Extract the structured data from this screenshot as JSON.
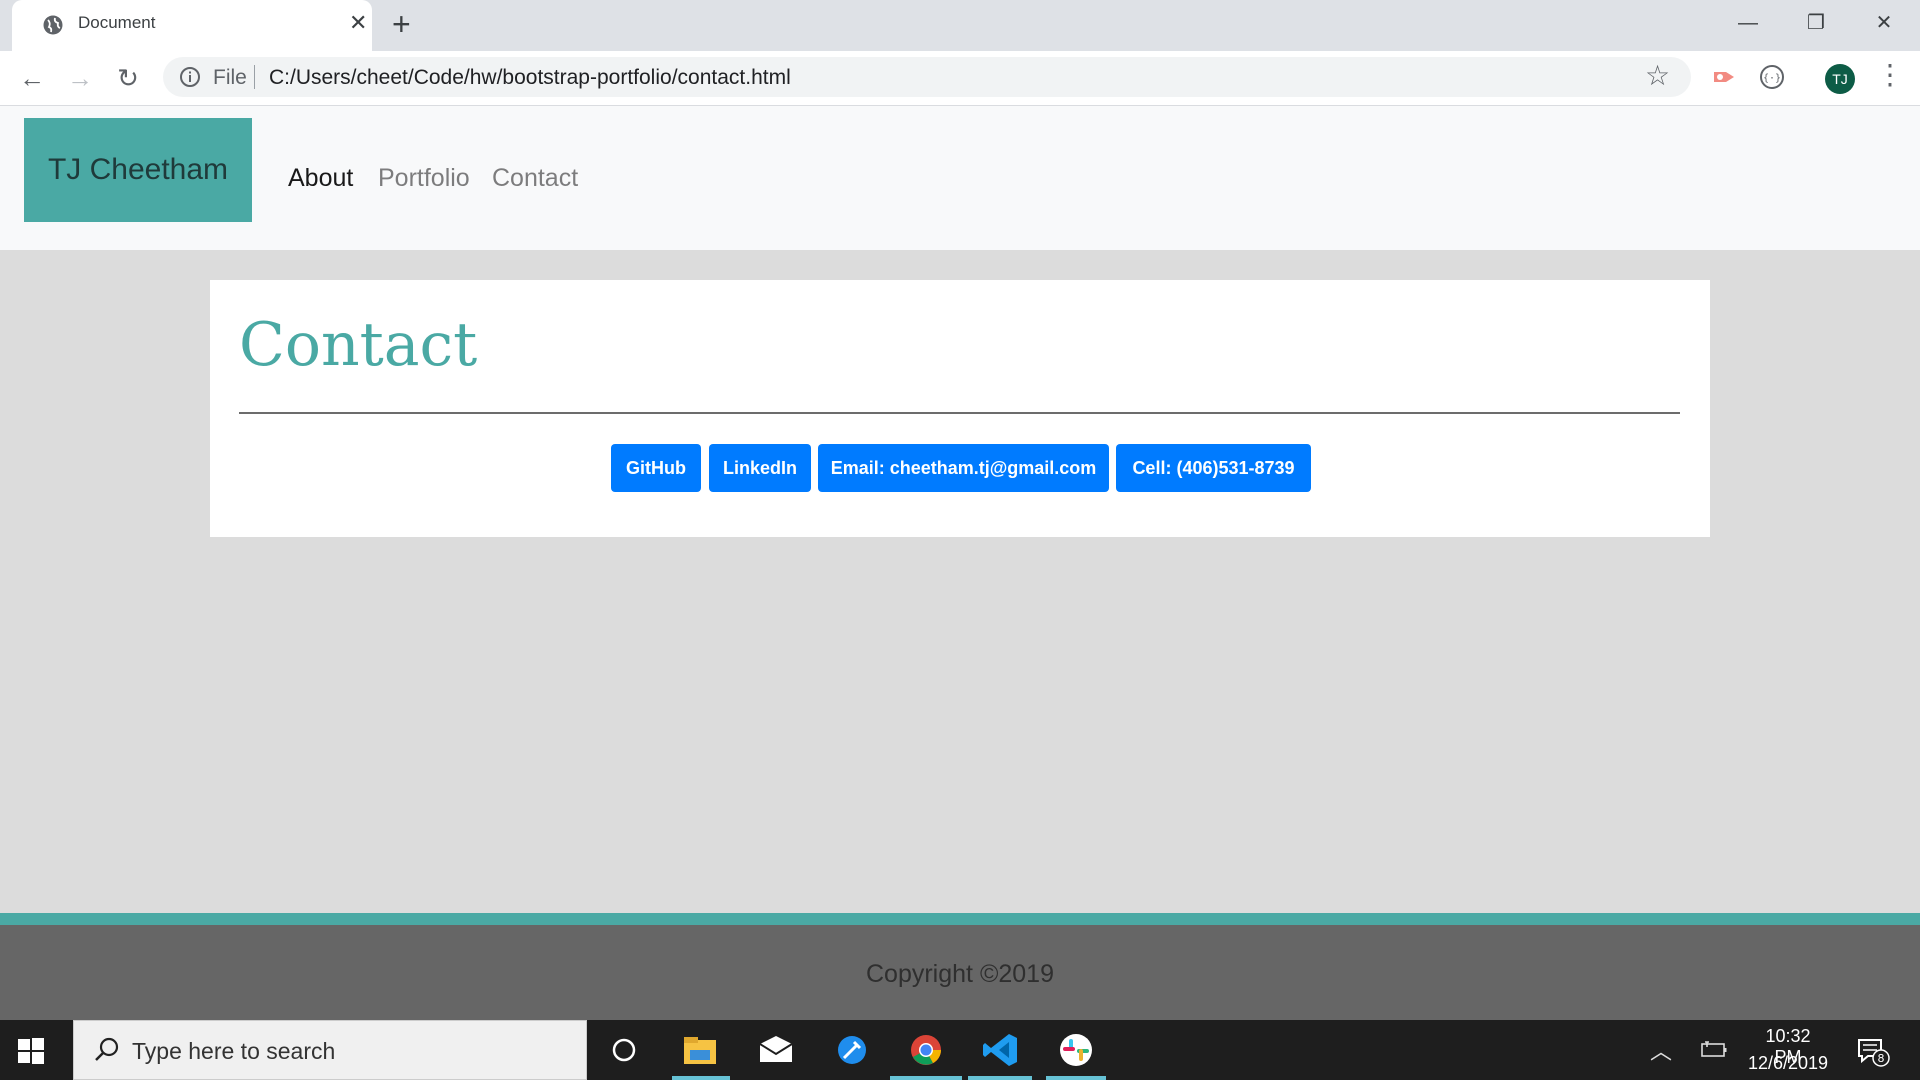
{
  "browser": {
    "tab_title": "Document",
    "tab_close": "✕",
    "new_tab": "+",
    "window_controls": {
      "minimize": "—",
      "restore": "❐",
      "close": "✕"
    },
    "nav": {
      "back": "←",
      "forward": "→",
      "reload": "↻"
    },
    "omnibox": {
      "scheme_label": "File",
      "url": "C:/Users/cheet/Code/hw/bootstrap-portfolio/contact.html"
    },
    "bookmark_star": "☆",
    "profile_initials": "TJ",
    "menu": "⋮"
  },
  "site": {
    "brand": "TJ Cheetham",
    "nav_links": [
      {
        "label": "About",
        "active": true
      },
      {
        "label": "Portfolio",
        "active": false
      },
      {
        "label": "Contact",
        "active": false
      }
    ],
    "card": {
      "title": "Contact",
      "buttons": [
        {
          "label": "GitHub"
        },
        {
          "label": "LinkedIn"
        },
        {
          "label": "Email: cheetham.tj@gmail.com"
        },
        {
          "label": "Cell: (406)531-8739"
        }
      ]
    },
    "footer": "Copyright ©2019",
    "colors": {
      "accent": "#4aa9a4",
      "button": "#007bff",
      "footer_bg": "#666666",
      "page_bg": "#dcdcdc"
    }
  },
  "taskbar": {
    "search_placeholder": "Type here to search",
    "time": "10:32 PM",
    "date": "12/6/2019",
    "notification_count": "8",
    "apps": [
      "cortana-icon",
      "file-explorer-icon",
      "mail-icon",
      "visual-studio-installer-icon",
      "chrome-icon",
      "vscode-icon",
      "slack-icon"
    ]
  }
}
